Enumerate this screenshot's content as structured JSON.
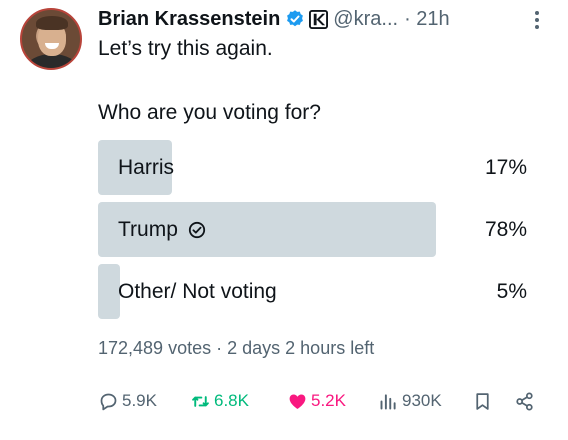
{
  "author": {
    "display_name": "Brian Krassenstein",
    "handle": "@kra...",
    "timestamp_separator": "·",
    "timestamp": "21h",
    "verified_color": "#1d9bf0"
  },
  "tweet": {
    "text": "Let’s try this again."
  },
  "poll": {
    "question": "Who are you voting for?",
    "options": [
      {
        "label": "Harris",
        "percent_label": "17%",
        "percent": 17,
        "winner": false
      },
      {
        "label": "Trump",
        "percent_label": "78%",
        "percent": 78,
        "winner": true
      },
      {
        "label": "Other/ Not voting",
        "percent_label": "5%",
        "percent": 5,
        "winner": false
      }
    ],
    "votes": "172,489 votes",
    "separator": "·",
    "time_left": "2 days 2 hours left",
    "bar_color": "#cfd9de"
  },
  "actions": {
    "replies": "5.9K",
    "retweets": "6.8K",
    "likes": "5.2K",
    "views": "930K",
    "retweet_color": "#00ba7c",
    "like_color": "#f91880",
    "icons": [
      "reply-icon",
      "retweet-icon",
      "heart-icon",
      "views-icon",
      "bookmark-icon",
      "share-icon"
    ]
  }
}
